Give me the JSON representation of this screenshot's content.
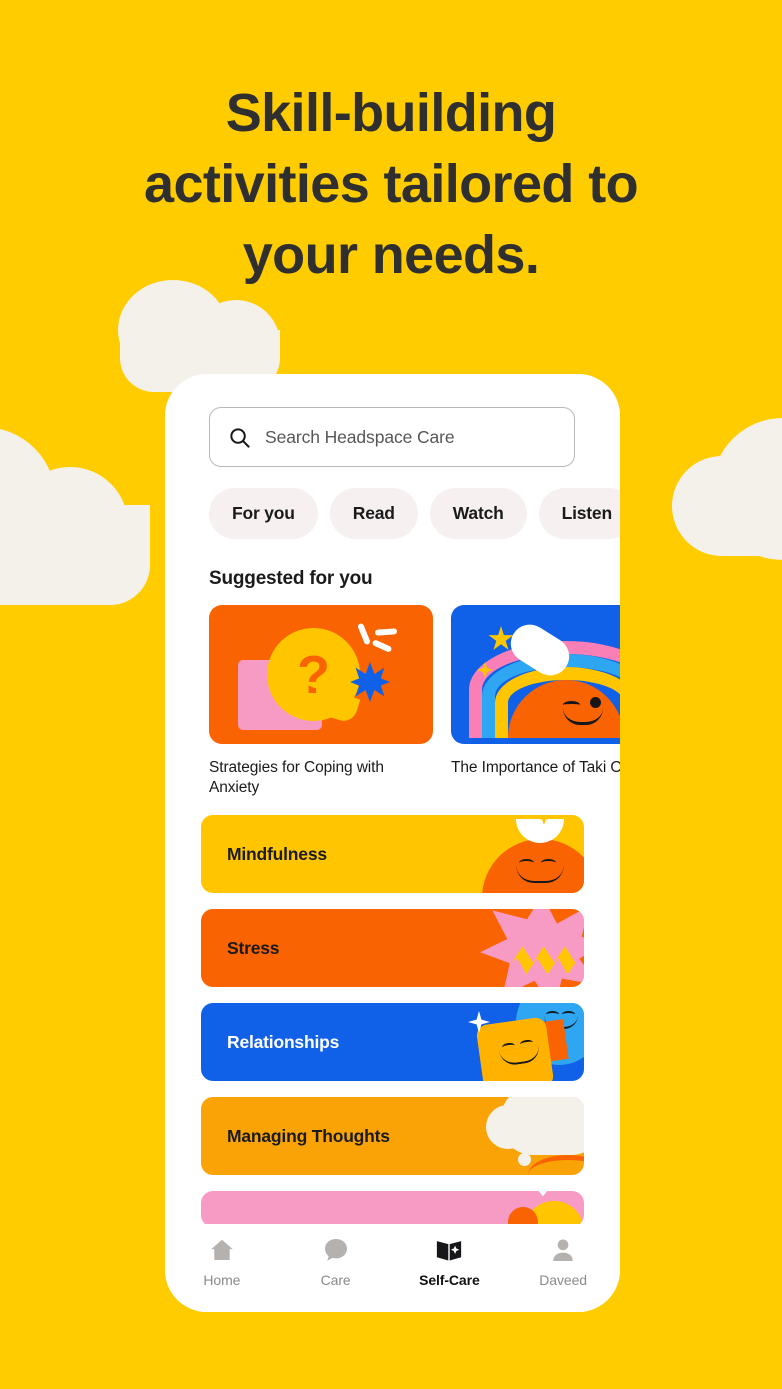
{
  "hero": {
    "lines": [
      "Skill-building",
      "activities tailored to",
      "your needs."
    ],
    "background_color": "#FFCC00",
    "text_color": "#2F2F2F"
  },
  "decor": {
    "cloud_color": "#F4F1EB",
    "clouds": [
      "cloud-top-left",
      "cloud-left",
      "cloud-right"
    ]
  },
  "app": {
    "search": {
      "placeholder": "Search Headspace Care",
      "value": "",
      "icon": "search-icon"
    },
    "filter_chips": [
      {
        "label": "For you",
        "selected": false
      },
      {
        "label": "Read",
        "selected": false
      },
      {
        "label": "Watch",
        "selected": false
      },
      {
        "label": "Listen",
        "selected": false
      },
      {
        "label": "",
        "selected": false
      }
    ],
    "suggested": {
      "section_title": "Suggested for you",
      "cards": [
        {
          "title": "Strategies for Coping with Anxiety",
          "art": "question-speech-bubble",
          "bg_color": "#F96302"
        },
        {
          "title": "The Importance of Taki Off",
          "art": "rainbow-sun",
          "bg_color": "#1160E8"
        }
      ]
    },
    "categories": [
      {
        "label": "Mindfulness",
        "bg_color": "#FFC600",
        "text_color": "#1B1B1B",
        "art": "meditating-figure"
      },
      {
        "label": "Stress",
        "bg_color": "#F96302",
        "text_color": "#1B1B1B",
        "art": "lightning-burst"
      },
      {
        "label": "Relationships",
        "bg_color": "#1160E8",
        "text_color": "#FFFFFF",
        "art": "two-faces"
      },
      {
        "label": "Managing Thoughts",
        "bg_color": "#FAA307",
        "text_color": "#1B1B1B",
        "art": "thought-cloud"
      },
      {
        "label": "",
        "bg_color": "#F79BC4",
        "text_color": "#1B1B1B",
        "art": "partial-peek"
      }
    ],
    "bottom_nav": [
      {
        "label": "Home",
        "icon": "home-icon",
        "active": false
      },
      {
        "label": "Care",
        "icon": "chat-bubble-icon",
        "active": false
      },
      {
        "label": "Self-Care",
        "icon": "open-book-icon",
        "active": true
      },
      {
        "label": "Daveed",
        "icon": "person-icon",
        "active": false
      }
    ]
  }
}
